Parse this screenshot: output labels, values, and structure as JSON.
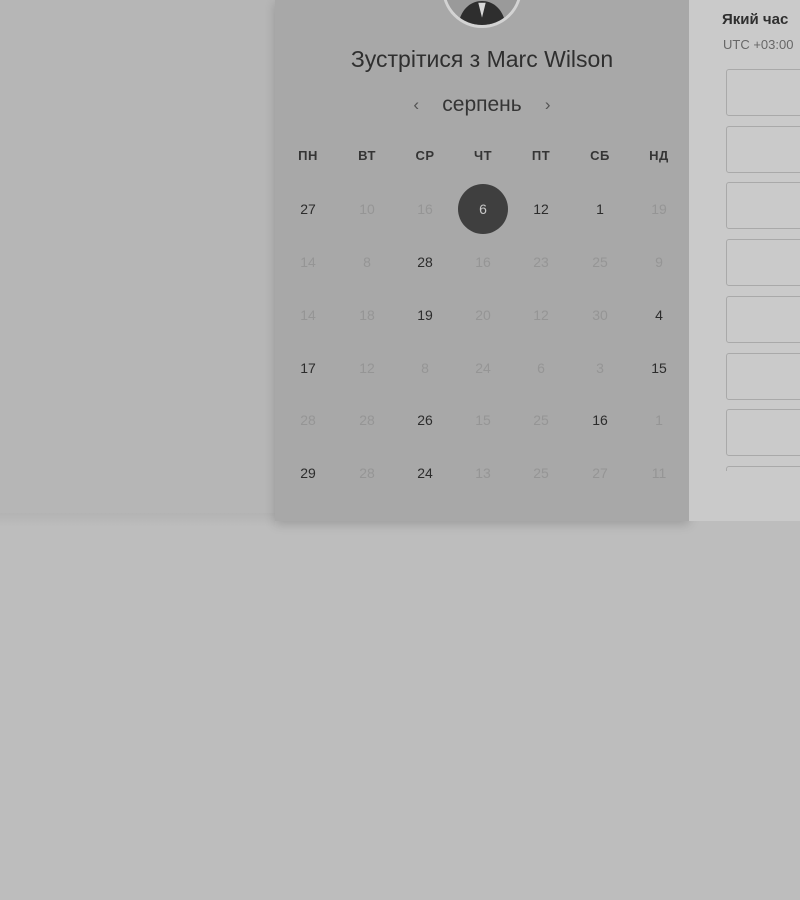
{
  "page": {
    "title": "Зустрітися з Marc Wilson"
  },
  "calendar": {
    "month": "серпень",
    "prev_icon": "‹",
    "next_icon": "›",
    "weekdays": [
      "ПН",
      "ВТ",
      "СР",
      "ЧТ",
      "ПТ",
      "СБ",
      "НД"
    ],
    "weeks": [
      [
        {
          "d": "27",
          "s": "avail"
        },
        {
          "d": "10",
          "s": "muted"
        },
        {
          "d": "16",
          "s": "muted"
        },
        {
          "d": "6",
          "s": "selected"
        },
        {
          "d": "12",
          "s": "avail"
        },
        {
          "d": "1",
          "s": "avail"
        },
        {
          "d": "19",
          "s": "muted"
        }
      ],
      [
        {
          "d": "14",
          "s": "muted"
        },
        {
          "d": "8",
          "s": "muted"
        },
        {
          "d": "28",
          "s": "avail"
        },
        {
          "d": "16",
          "s": "muted"
        },
        {
          "d": "23",
          "s": "muted"
        },
        {
          "d": "25",
          "s": "muted"
        },
        {
          "d": "9",
          "s": "muted"
        }
      ],
      [
        {
          "d": "14",
          "s": "muted"
        },
        {
          "d": "18",
          "s": "muted"
        },
        {
          "d": "19",
          "s": "avail"
        },
        {
          "d": "20",
          "s": "muted"
        },
        {
          "d": "12",
          "s": "muted"
        },
        {
          "d": "30",
          "s": "muted"
        },
        {
          "d": "4",
          "s": "avail"
        }
      ],
      [
        {
          "d": "17",
          "s": "avail"
        },
        {
          "d": "12",
          "s": "muted"
        },
        {
          "d": "8",
          "s": "muted"
        },
        {
          "d": "24",
          "s": "muted"
        },
        {
          "d": "6",
          "s": "muted"
        },
        {
          "d": "3",
          "s": "muted"
        },
        {
          "d": "15",
          "s": "avail"
        }
      ],
      [
        {
          "d": "28",
          "s": "muted"
        },
        {
          "d": "28",
          "s": "muted"
        },
        {
          "d": "26",
          "s": "avail"
        },
        {
          "d": "15",
          "s": "muted"
        },
        {
          "d": "25",
          "s": "muted"
        },
        {
          "d": "16",
          "s": "avail"
        },
        {
          "d": "1",
          "s": "muted"
        }
      ],
      [
        {
          "d": "29",
          "s": "avail"
        },
        {
          "d": "28",
          "s": "muted"
        },
        {
          "d": "24",
          "s": "avail"
        },
        {
          "d": "13",
          "s": "muted"
        },
        {
          "d": "25",
          "s": "muted"
        },
        {
          "d": "27",
          "s": "muted"
        },
        {
          "d": "11",
          "s": "muted"
        }
      ]
    ]
  },
  "time_panel": {
    "heading": "Який час",
    "timezone": "UTC +03:00",
    "slot_count": 8
  },
  "colors": {
    "selected_day": "#3f3f3f",
    "panel": "#a8a8a8",
    "background": "#bdbdbd"
  }
}
